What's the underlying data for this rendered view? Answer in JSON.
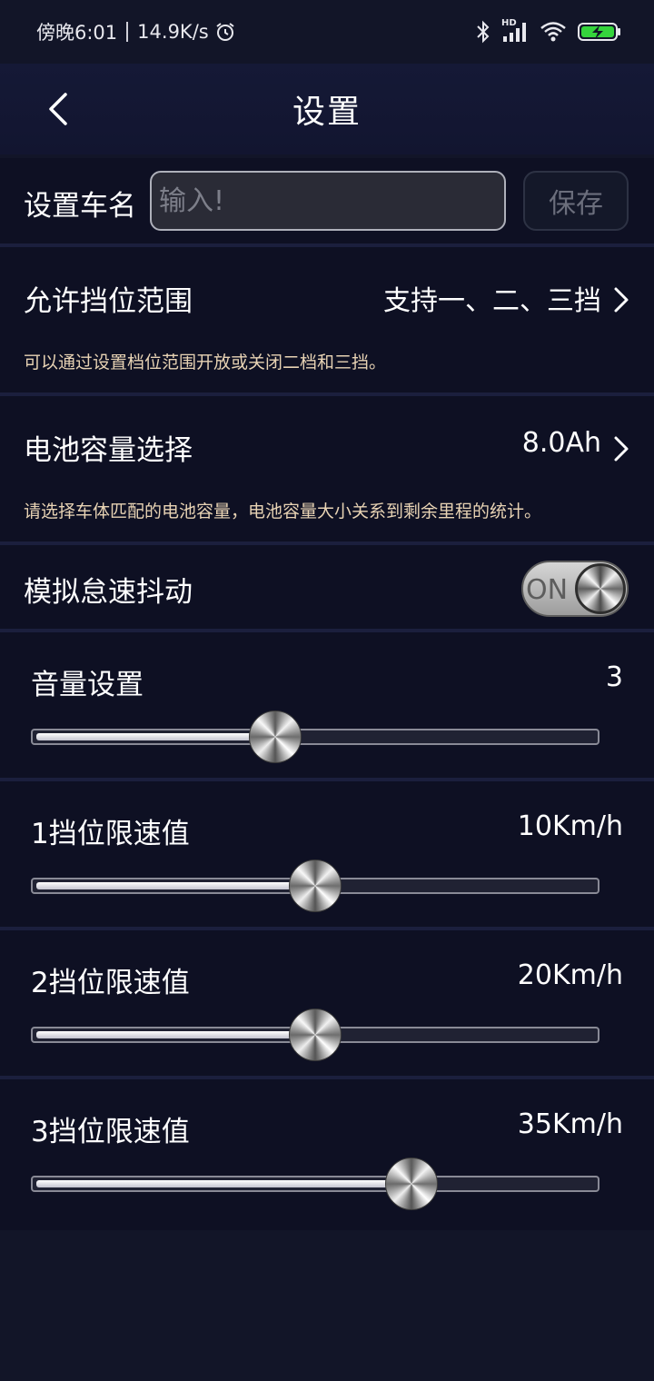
{
  "status_bar": {
    "time": "傍晚6:01",
    "net_speed": "14.9K/s",
    "hd_label": "HD"
  },
  "header": {
    "title": "设置"
  },
  "car_name": {
    "label": "设置车名",
    "placeholder": "输入!",
    "value": "",
    "save_label": "保存"
  },
  "gear_range": {
    "label": "允许挡位范围",
    "value": "支持一、二、三挡",
    "description": "可以通过设置档位范围开放或关闭二档和三挡。"
  },
  "battery": {
    "label": "电池容量选择",
    "value": "8.0Ah",
    "description": "请选择车体匹配的电池容量，电池容量大小关系到剩余里程的统计。"
  },
  "shake": {
    "label": "模拟怠速抖动",
    "toggle_text": "ON",
    "enabled": true
  },
  "sliders": [
    {
      "label": "音量设置",
      "value": "3",
      "fraction": 0.43
    },
    {
      "label": "1挡位限速值",
      "value": "10Km/h",
      "fraction": 0.5
    },
    {
      "label": "2挡位限速值",
      "value": "20Km/h",
      "fraction": 0.5
    },
    {
      "label": "3挡位限速值",
      "value": "35Km/h",
      "fraction": 0.67
    }
  ],
  "colors": {
    "background": "#121528",
    "row_background": "#0e1023",
    "description_text": "#e8d3b4"
  }
}
